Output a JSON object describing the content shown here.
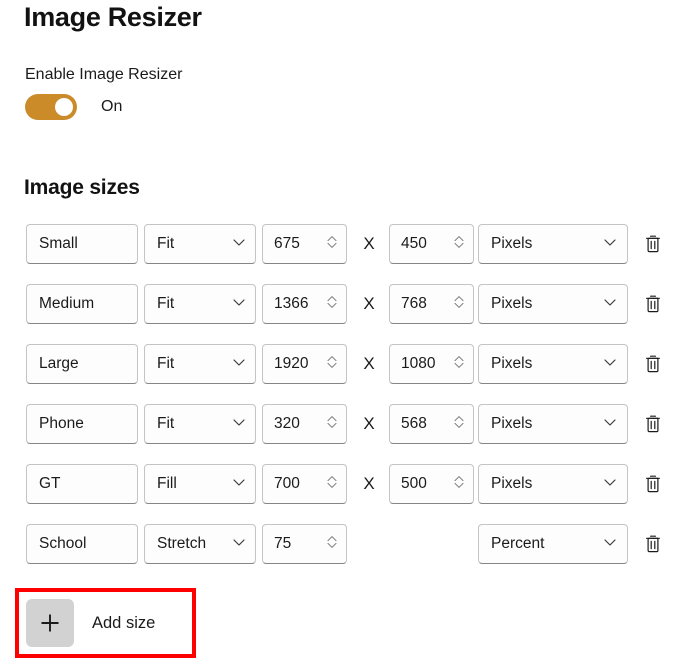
{
  "page": {
    "title": "Image Resizer"
  },
  "enable": {
    "label": "Enable Image Resizer",
    "state_text": "On",
    "is_on": true,
    "accent_color": "#cc8b29"
  },
  "image_sizes": {
    "heading": "Image sizes",
    "separator": "X",
    "rows": [
      {
        "name": "Small",
        "fit": "Fit",
        "width": "675",
        "height": "450",
        "unit": "Pixels",
        "has_height": true
      },
      {
        "name": "Medium",
        "fit": "Fit",
        "width": "1366",
        "height": "768",
        "unit": "Pixels",
        "has_height": true
      },
      {
        "name": "Large",
        "fit": "Fit",
        "width": "1920",
        "height": "1080",
        "unit": "Pixels",
        "has_height": true
      },
      {
        "name": "Phone",
        "fit": "Fit",
        "width": "320",
        "height": "568",
        "unit": "Pixels",
        "has_height": true
      },
      {
        "name": "GT",
        "fit": "Fill",
        "width": "700",
        "height": "500",
        "unit": "Pixels",
        "has_height": true
      },
      {
        "name": "School",
        "fit": "Stretch",
        "width": "75",
        "height": "",
        "unit": "Percent",
        "has_height": false
      }
    ],
    "delete_icon": "trash-icon",
    "dropdown_icon": "chevron-down-icon",
    "spinner_icon": "spinner-updown-icon"
  },
  "add_size": {
    "label": "Add size",
    "plus_icon": "plus-icon",
    "highlight_color": "#ff0000"
  }
}
